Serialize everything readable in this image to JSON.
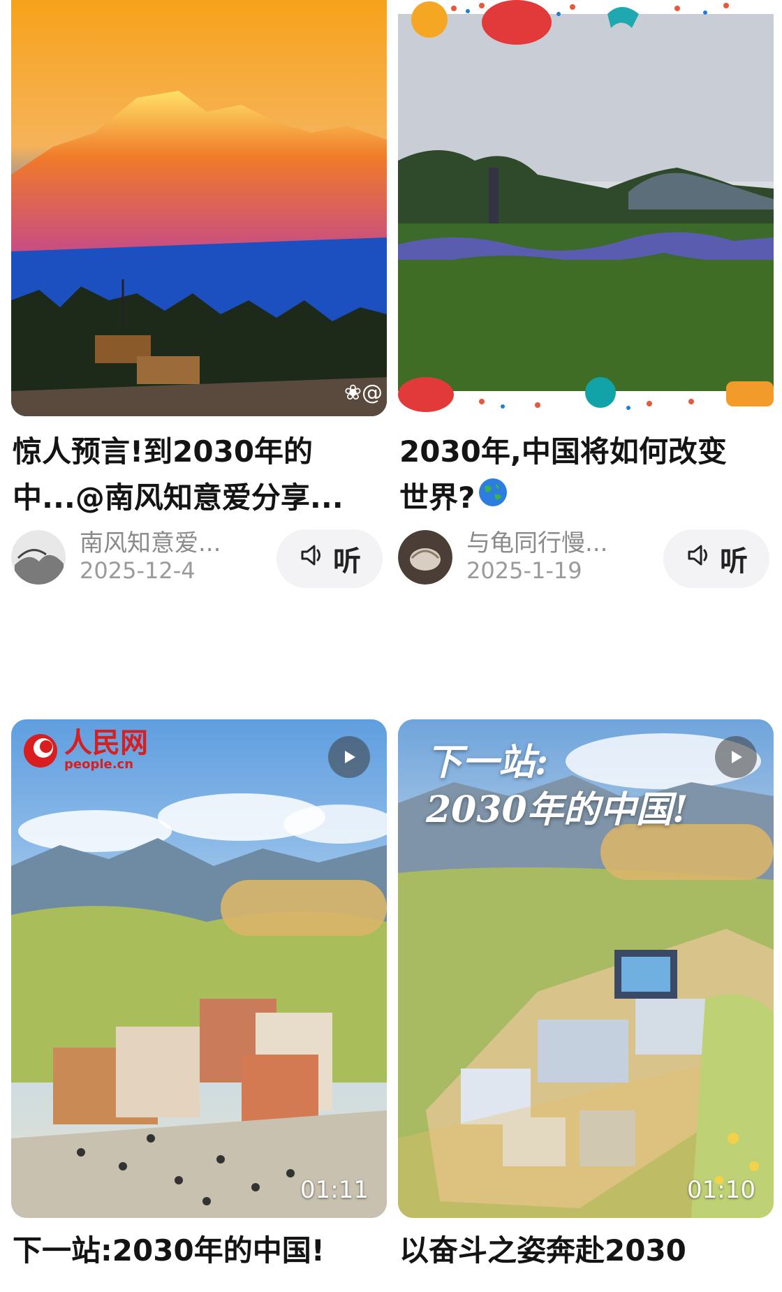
{
  "cards": [
    {
      "title_line1": "惊人预言!到2030年的",
      "title_line2": "中...@南风知意爱分享...",
      "author": "南风知意爱...",
      "date": "2025-12-4",
      "listen_label": "听",
      "watermark": "❀@"
    },
    {
      "title_line1": "2030年,中国将如何改变",
      "title_line2": "世界?",
      "title_emoji": "globe-emoji",
      "author": "与龟同行慢...",
      "date": "2025-1-19",
      "listen_label": "听"
    },
    {
      "logo_text": "人民网",
      "logo_sub": "people.cn",
      "duration": "01:11",
      "title_line1": "下一站:2030年的中国!",
      "icon": "play-icon"
    },
    {
      "overlay_line1": "下一站:",
      "overlay_line2": "2030年的中国!",
      "duration": "01:10",
      "title_line1": "以奋斗之姿奔赴2030",
      "icon": "play-icon"
    }
  ],
  "colors": {
    "title": "#141414",
    "meta": "#8a8a8a",
    "listen_bg": "#f3f3f5",
    "brand_red": "#d81e1e"
  }
}
